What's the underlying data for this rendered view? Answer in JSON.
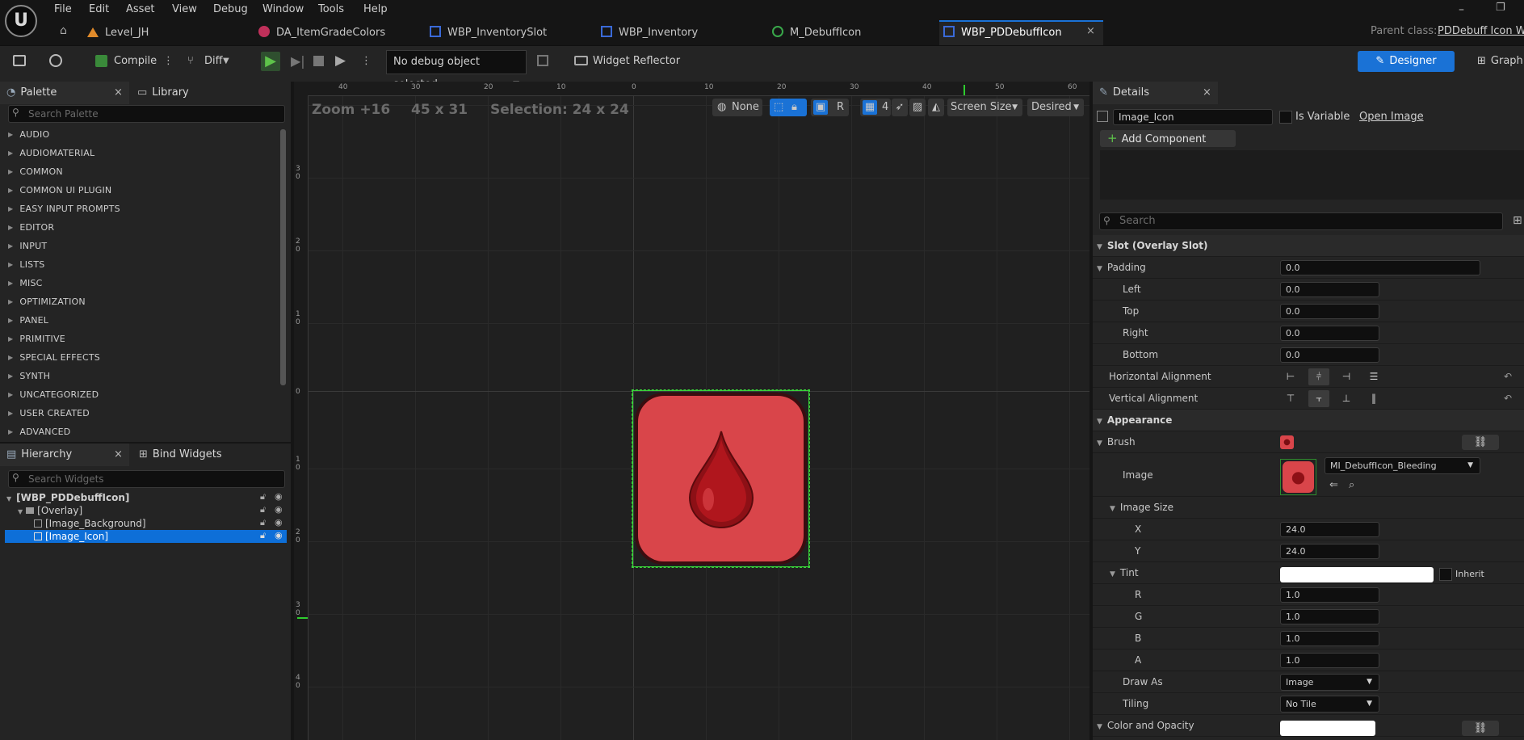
{
  "menu": [
    "File",
    "Edit",
    "Asset",
    "View",
    "Debug",
    "Window",
    "Tools",
    "Help"
  ],
  "tabs": [
    {
      "label": "Level_JH",
      "color": "#e08a2a"
    },
    {
      "label": "DA_ItemGradeColors",
      "color": "#c0305a"
    },
    {
      "label": "WBP_InventorySlot",
      "color": "#3a6ad8"
    },
    {
      "label": "WBP_Inventory",
      "color": "#3a6ad8"
    },
    {
      "label": "M_DebuffIcon",
      "color": "#39a84a"
    },
    {
      "label": "WBP_PDDebuffIcon",
      "color": "#3a6ad8"
    }
  ],
  "parent_class": {
    "label": "Parent class:",
    "value": "PDDebuff Icon Wid"
  },
  "toolbar": {
    "compile": "Compile",
    "diff": "Diff",
    "debug_object": "No debug object selected",
    "widget_reflector": "Widget Reflector",
    "designer": "Designer",
    "graph": "Graph"
  },
  "palette": {
    "tab": "Palette",
    "library_tab": "Library",
    "search_placeholder": "Search Palette",
    "categories": [
      "AUDIO",
      "AUDIOMATERIAL",
      "COMMON",
      "COMMON UI PLUGIN",
      "EASY INPUT PROMPTS",
      "EDITOR",
      "INPUT",
      "LISTS",
      "MISC",
      "OPTIMIZATION",
      "PANEL",
      "PRIMITIVE",
      "SPECIAL EFFECTS",
      "SYNTH",
      "UNCATEGORIZED",
      "USER CREATED",
      "ADVANCED"
    ]
  },
  "hierarchy": {
    "tab": "Hierarchy",
    "bind_tab": "Bind Widgets",
    "search_placeholder": "Search Widgets",
    "root": "[WBP_PDDebuffIcon]",
    "overlay": "[Overlay]",
    "items": [
      "[Image_Background]",
      "[Image_Icon]"
    ]
  },
  "viewport": {
    "zoom": "Zoom +16",
    "size": "45 x 31",
    "selection": "Selection: 24 x 24",
    "none": "None",
    "r": "R",
    "grid_num": "4",
    "screen_size": "Screen Size",
    "desired": "Desired",
    "ruler_top": [
      "40",
      "30",
      "20",
      "10",
      "0",
      "10",
      "20",
      "30",
      "40",
      "50",
      "60"
    ],
    "ruler_left": [
      "3 0",
      "2 0",
      "1 0",
      "0",
      "1 0",
      "2 0",
      "3 0",
      "4 0"
    ]
  },
  "details": {
    "tab": "Details",
    "widget_name": "Image_Icon",
    "is_variable": "Is Variable",
    "open_image": "Open Image",
    "add_component": "Add Component",
    "search_placeholder": "Search",
    "slot_section": "Slot (Overlay Slot)",
    "padding": {
      "label": "Padding",
      "value": "0.0",
      "left": "Left",
      "top": "Top",
      "right": "Right",
      "bottom": "Bottom",
      "left_v": "0.0",
      "top_v": "0.0",
      "right_v": "0.0",
      "bottom_v": "0.0"
    },
    "h_align": "Horizontal Alignment",
    "v_align": "Vertical Alignment",
    "appearance": "Appearance",
    "brush": "Brush",
    "image": "Image",
    "image_asset": "MI_DebuffIcon_Bleeding",
    "image_size": "Image Size",
    "x": "X",
    "x_v": "24.0",
    "y": "Y",
    "y_v": "24.0",
    "tint": "Tint",
    "inherit": "Inherit",
    "r": "R",
    "r_v": "1.0",
    "g": "G",
    "g_v": "1.0",
    "b": "B",
    "b_v": "1.0",
    "a": "A",
    "a_v": "1.0",
    "draw_as": "Draw As",
    "draw_as_v": "Image",
    "tiling": "Tiling",
    "tiling_v": "No Tile",
    "color_opacity": "Color and Opacity"
  }
}
